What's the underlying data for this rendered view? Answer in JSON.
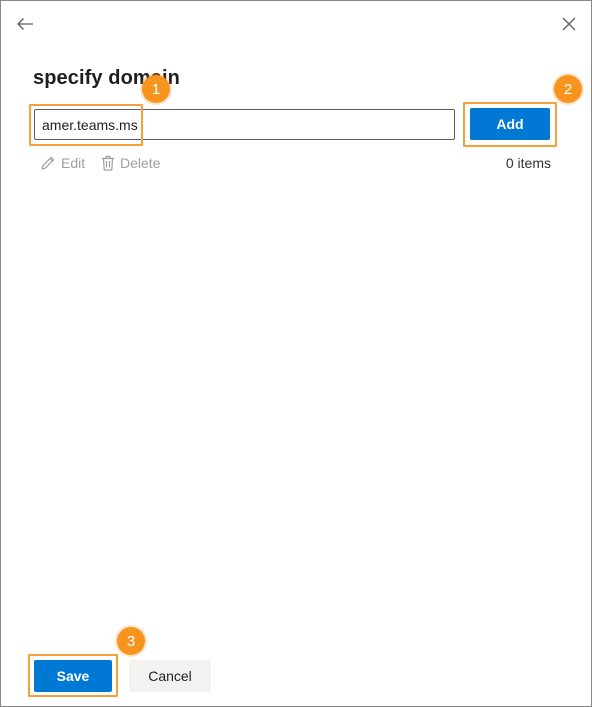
{
  "panel": {
    "title": "specify domain"
  },
  "domain_input": {
    "value": "amer.teams.ms",
    "placeholder": ""
  },
  "buttons": {
    "add_label": "Add",
    "save_label": "Save",
    "cancel_label": "Cancel"
  },
  "commands": {
    "edit_label": "Edit",
    "delete_label": "Delete"
  },
  "list": {
    "count_label": "0 items"
  },
  "callouts": [
    "1",
    "2",
    "3"
  ],
  "icons": {
    "back": "arrow-left-icon",
    "close": "close-icon",
    "edit": "pencil-icon",
    "delete": "trash-icon"
  },
  "colors": {
    "primary": "#0078d4",
    "callout": "#f7941e",
    "highlight": "#f5a03c",
    "disabled_text": "#a19f9d"
  }
}
